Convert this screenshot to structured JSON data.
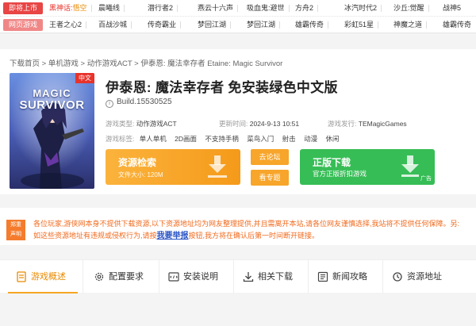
{
  "toplinks": {
    "row1": {
      "tag": "即将上市",
      "items": [
        {
          "prefix": "黑神话:",
          "name": "悟空"
        },
        {
          "name": "晨曦线"
        },
        {
          "name": "潜行者2"
        },
        {
          "name": "燕云十六声"
        },
        {
          "name": "吸血鬼:避世"
        },
        {
          "name": "方舟2"
        },
        {
          "name": "冰汽时代2"
        },
        {
          "name": "沙丘:觉醒"
        },
        {
          "name": "战神5"
        }
      ]
    },
    "row2": {
      "tag": "网页游戏",
      "items": [
        {
          "name": "王者之心2"
        },
        {
          "name": "百战沙城"
        },
        {
          "name": "传奇霸业"
        },
        {
          "name": "梦回江湖"
        },
        {
          "name": "梦回江湖"
        },
        {
          "name": "雄霸传奇"
        },
        {
          "name": "彩虹51星"
        },
        {
          "name": "神魔之道"
        },
        {
          "name": "雄霸传奇"
        }
      ]
    }
  },
  "breadcrumb": {
    "home": "下载首页",
    "l2": "单机游戏",
    "l3": "动作游戏ACT",
    "l4": "伊泰恩: 魔法幸存者 Etaine: Magic Survivor",
    "sep": " > "
  },
  "cover": {
    "badge": "中文",
    "line1": "MAGIC",
    "line2": "SURVIVOR"
  },
  "game": {
    "title": "伊泰恩: 魔法幸存者 免安装绿色中文版",
    "build": "Build.15530525",
    "type_label": "游戏类型:",
    "type_value": "动作游戏ACT",
    "time_label": "更新时间:",
    "time_value": "2024-9-13 10:51",
    "publisher_label": "游戏发行:",
    "publisher_value": "TEMagicGames",
    "tags_label": "游戏标签:",
    "tags": [
      "单人单机",
      "2D画面",
      "不支持手柄",
      "菜鸟入门",
      "射击",
      "动漫",
      "休闲"
    ]
  },
  "download": {
    "title": "资源检索",
    "size_label": "文件大小:",
    "size_value": "120M",
    "forum": "去论坛",
    "topic": "看专题",
    "official_title": "正版下载",
    "official_sub": "官方正版折扣游戏",
    "ad": "广告"
  },
  "notice": {
    "badge_line1": "郑重",
    "badge_line2": "声明",
    "text_before": "各位玩家,游侠网本身不提供下载资源,以下资源地址均为网友整理提供,并且需离开本站,请各位网友谨慎选择,我站将不提供任何保障。另:如这些资源地址有违规或侵权行为,请按",
    "report": "我要举报",
    "text_after": "按钮,我方将在确认后第一时间断开链接。"
  },
  "tabs": [
    {
      "label": "游戏概述",
      "icon": "document-icon"
    },
    {
      "label": "配置要求",
      "icon": "gear-icon"
    },
    {
      "label": "安装说明",
      "icon": "code-icon"
    },
    {
      "label": "相关下载",
      "icon": "download-icon"
    },
    {
      "label": "新闻攻略",
      "icon": "news-icon"
    },
    {
      "label": "资源地址",
      "icon": "refresh-icon"
    }
  ],
  "colors": {
    "accent_orange": "#f5a623",
    "accent_green": "#37bd56",
    "notice_text": "#f06a1e",
    "link_blue": "#2a54c6"
  }
}
